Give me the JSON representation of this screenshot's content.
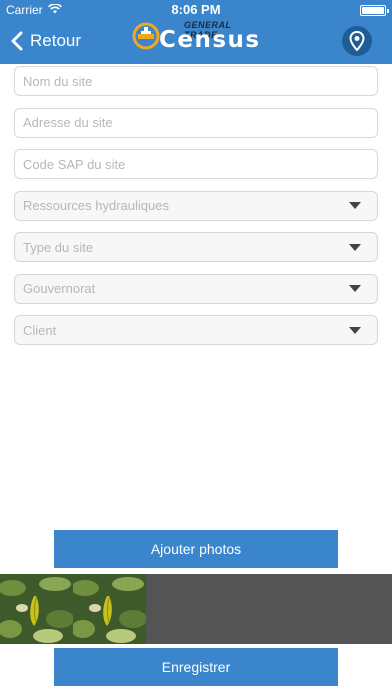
{
  "status_bar": {
    "carrier": "Carrier",
    "time": "8:06 PM"
  },
  "nav": {
    "back_label": "Retour",
    "logo_tagline": "GENERAL TRADE",
    "logo_text": "Census",
    "accent_color": "#3a85cc"
  },
  "form": {
    "fields": [
      {
        "placeholder": "Nom du site"
      },
      {
        "placeholder": "Adresse du site"
      },
      {
        "placeholder": "Code SAP du site"
      }
    ],
    "selects": [
      {
        "placeholder": "Ressources hydrauliques"
      },
      {
        "placeholder": "Type du site"
      },
      {
        "placeholder": "Gouvernorat"
      },
      {
        "placeholder": "Client"
      }
    ]
  },
  "actions": {
    "add_photos_label": "Ajouter photos",
    "save_label": "Enregistrer"
  },
  "gallery": {
    "photos": [
      {
        "icon": "photo-thumbnail"
      },
      {
        "icon": "photo-thumbnail"
      }
    ]
  }
}
